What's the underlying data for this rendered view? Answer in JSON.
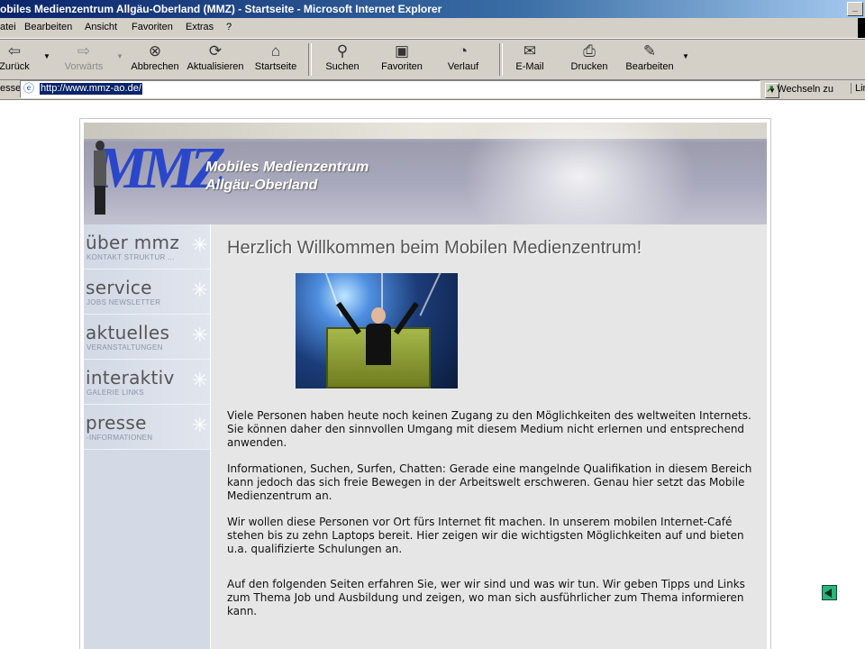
{
  "window": {
    "title": "obiles Medienzentrum Allgäu-Oberland (MMZ) - Startseite - Microsoft Internet Explorer",
    "controls": [
      "_"
    ]
  },
  "menu": {
    "items": [
      "atei",
      "Bearbeiten",
      "Ansicht",
      "Favoriten",
      "Extras",
      "?"
    ]
  },
  "toolbar": {
    "back": "Zurück",
    "forward": "Vorwärts",
    "stop": "Abbrechen",
    "refresh": "Aktualisieren",
    "home": "Startseite",
    "search": "Suchen",
    "favorites": "Favoriten",
    "history": "Verlauf",
    "mail": "E-Mail",
    "print": "Drucken",
    "edit": "Bearbeiten"
  },
  "address": {
    "label": "esse",
    "url": "http://www.mmz-ao.de/",
    "go": "Wechseln zu",
    "links": "Lin"
  },
  "site": {
    "name_line1": "Mobiles Medienzentrum",
    "name_line2": "Allgäu-Oberland",
    "logo": "MMZ",
    "nav": [
      {
        "title": "über mmz",
        "sub": "KONTAKT STRUKTUR ..."
      },
      {
        "title": "service",
        "sub": "JOBS NEWSLETTER"
      },
      {
        "title": "aktuelles",
        "sub": "VERANSTALTUNGEN"
      },
      {
        "title": "interaktiv",
        "sub": "GALERIE LINKS"
      },
      {
        "title": "presse",
        "sub": "-INFORMATIONEN"
      }
    ],
    "headline": "Herzlich Willkommen beim Mobilen Medienzentrum!",
    "paragraphs": [
      "Viele Personen haben heute noch keinen Zugang zu den Möglichkeiten des weltweiten Internets. Sie können daher den sinnvollen Umgang mit diesem Medium nicht erlernen und entsprechend anwenden.",
      "Informationen, Suchen, Surfen, Chatten:  Gerade eine mangelnde Qualifikation in diesem Bereich kann jedoch das sich freie Bewegen in der Arbeitswelt erschweren. Genau hier setzt das Mobile Medienzentrum an.",
      "Wir wollen diese Personen vor Ort fürs Internet fit machen. In unserem mobilen Internet-Café stehen bis zu zehn Laptops bereit. Hier zeigen wir die wichtigsten Möglichkeiten auf und bieten u.a. qualifizierte Schulungen an.",
      "Auf den folgenden Seiten erfahren Sie, wer wir sind und was wir tun. Wir geben Tipps und Links zum Thema Job und Ausbildung und zeigen, wo man sich ausführlicher zum Thema informieren kann."
    ]
  },
  "icons": {
    "back": "back-arrow-icon",
    "forward": "forward-arrow-icon",
    "stop": "stop-icon",
    "refresh": "refresh-icon",
    "home": "home-icon",
    "search": "search-icon",
    "favorites": "favorites-icon",
    "history": "history-icon",
    "mail": "mail-icon",
    "print": "print-icon",
    "edit": "edit-icon",
    "ie": "ie-page-icon",
    "go": "go-arrow-icon",
    "nav_star": "sparkle-icon",
    "page_back": "page-back-icon"
  },
  "colors": {
    "titlebar": "#0a246a",
    "chrome": "#d4d0c8",
    "nav_bg": "#d3d9e5",
    "content_bg": "#e6e6e6",
    "logo": "#2b47c9",
    "arrow": "#2bb37e"
  }
}
